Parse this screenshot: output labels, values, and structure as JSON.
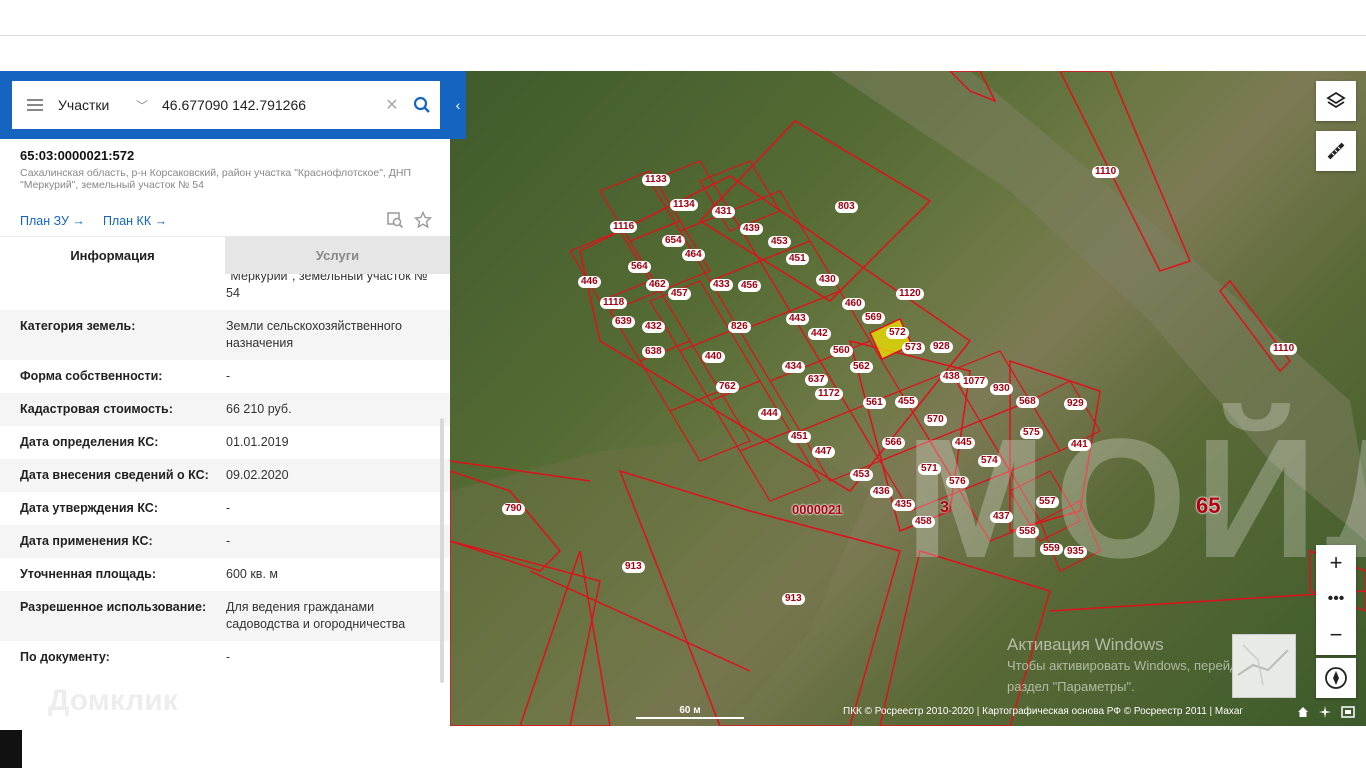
{
  "search": {
    "layer_label": "Участки",
    "query": "46.677090 142.791266"
  },
  "object": {
    "cadastral_number": "65:03:0000021:572",
    "address": "Сахалинская область, р-н Корсаковский, район участка \"Краснофлотское\", ДНП \"Меркурий\", земельный участок № 54"
  },
  "links": {
    "plan_zu": "План ЗУ →",
    "plan_kk": "План КК →"
  },
  "tabs": {
    "info": "Информация",
    "services": "Услуги"
  },
  "info_partial": "\"Меркурий\", земельный участок № 54",
  "info_rows": [
    {
      "key": "Категория земель:",
      "value": "Земли сельскохозяйственного назначения"
    },
    {
      "key": "Форма собственности:",
      "value": "-"
    },
    {
      "key": "Кадастровая стоимость:",
      "value": "66 210 руб."
    },
    {
      "key": "Дата определения КС:",
      "value": "01.01.2019"
    },
    {
      "key": "Дата внесения сведений о КС:",
      "value": "09.02.2020"
    },
    {
      "key": "Дата утверждения КС:",
      "value": "-"
    },
    {
      "key": "Дата применения КС:",
      "value": "-"
    },
    {
      "key": "Уточненная площадь:",
      "value": "600 кв. м"
    },
    {
      "key": "Разрешенное использование:",
      "value": "Для ведения гражданами садоводства и огородничества"
    },
    {
      "key": "По документу:",
      "value": "-"
    }
  ],
  "map": {
    "region_label": "65",
    "quarter_label": "0000021",
    "quarter_digit": "3",
    "watermark_brand": "МОЙДОМ",
    "domclick": "Домклик",
    "scale_label": "60 м",
    "attribution": "ПКК © Росреестр 2010-2020 | Картографическая основа РФ © Росреестр 2011 | Махаг",
    "windows_title": "Активация Windows",
    "windows_line1": "Чтобы активировать Windows, перейдите в",
    "windows_line2": "раздел \"Параметры\".",
    "plot_labels": [
      "1133",
      "1134",
      "431",
      "439",
      "453",
      "803",
      "1116",
      "654",
      "464",
      "451",
      "430",
      "446",
      "564",
      "462",
      "457",
      "433",
      "456",
      "460",
      "569",
      "1120",
      "1118",
      "639",
      "432",
      "826",
      "443",
      "442",
      "560",
      "572",
      "573",
      "928",
      "1110",
      "638",
      "440",
      "434",
      "637",
      "562",
      "438",
      "1077",
      "930",
      "568",
      "929",
      "762",
      "1172",
      "561",
      "455",
      "570",
      "444",
      "451",
      "447",
      "566",
      "445",
      "575",
      "441",
      "574",
      "453",
      "436",
      "571",
      "576",
      "435",
      "458",
      "437",
      "557",
      "790",
      "558",
      "559",
      "935",
      "913",
      "913",
      "1110"
    ]
  },
  "colors": {
    "accent": "#1565c0",
    "parcel_border": "#d0101c",
    "selected_parcel": "#f2e400"
  }
}
